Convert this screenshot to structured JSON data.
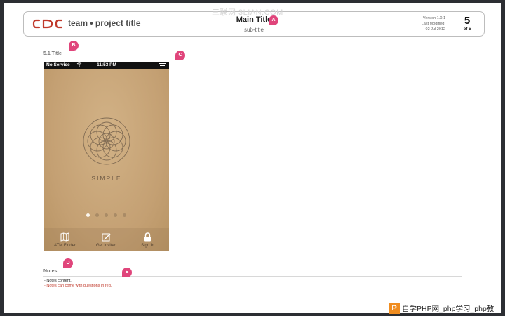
{
  "header": {
    "logo": "CDC",
    "team": "team • project title",
    "main_title": "Main Title",
    "sub_title": "sub-title",
    "version": "Version 1.0.1",
    "last_modified_label": "Last Modified:",
    "last_modified_date": "02 Jul 2012",
    "page_number": "5",
    "page_total": "of 5"
  },
  "markers": {
    "a": "A",
    "b": "B",
    "c": "C",
    "d": "D",
    "e": "E"
  },
  "section_title": "5.1 Title",
  "phone": {
    "carrier": "No Service",
    "time": "11:53 PM",
    "brand": "SIMPLE",
    "page_dots": {
      "count": 5,
      "active_index": 0
    },
    "tabs": [
      {
        "label": "ATM Finder",
        "icon": "map-book-icon"
      },
      {
        "label": "Get Invited",
        "icon": "pencil-note-icon"
      },
      {
        "label": "Sign In",
        "icon": "lock-icon"
      }
    ]
  },
  "notes": {
    "title": "Notes",
    "items": [
      "- Notes content.",
      "- Notes can come with questions in red."
    ]
  },
  "colors": {
    "marker": "#e0457b",
    "logo": "#c0392b",
    "phone_bg": "#c9a67b",
    "note_question": "#c0392b"
  },
  "watermarks": {
    "top": "三联网 3LIAN.COM",
    "bottom_box": "P",
    "bottom_text": "自学PHP网_php学习_php教"
  }
}
